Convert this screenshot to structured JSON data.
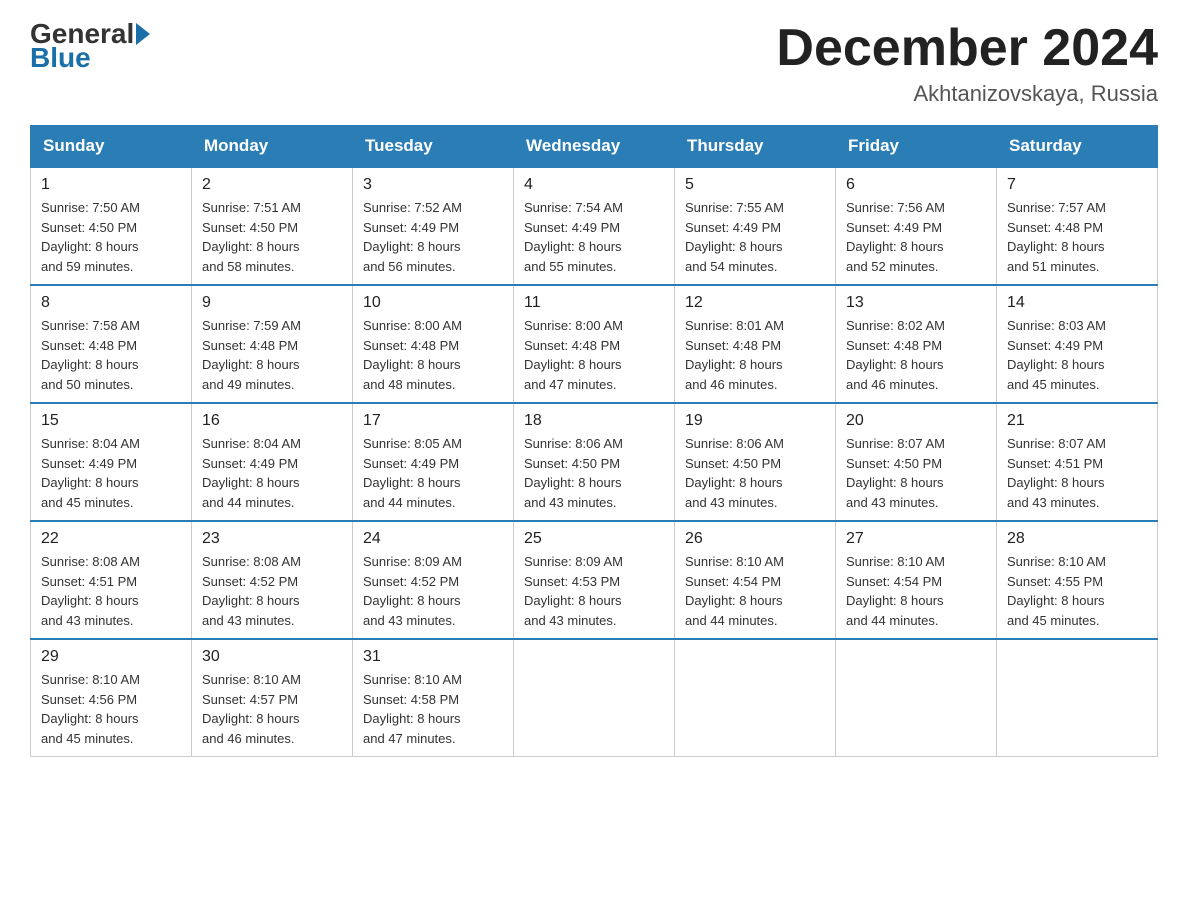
{
  "logo": {
    "general": "General",
    "blue": "Blue"
  },
  "header": {
    "month_year": "December 2024",
    "location": "Akhtanizovskaya, Russia"
  },
  "days_of_week": [
    "Sunday",
    "Monday",
    "Tuesday",
    "Wednesday",
    "Thursday",
    "Friday",
    "Saturday"
  ],
  "weeks": [
    [
      {
        "day": "1",
        "sunrise": "7:50 AM",
        "sunset": "4:50 PM",
        "daylight": "8 hours and 59 minutes."
      },
      {
        "day": "2",
        "sunrise": "7:51 AM",
        "sunset": "4:50 PM",
        "daylight": "8 hours and 58 minutes."
      },
      {
        "day": "3",
        "sunrise": "7:52 AM",
        "sunset": "4:49 PM",
        "daylight": "8 hours and 56 minutes."
      },
      {
        "day": "4",
        "sunrise": "7:54 AM",
        "sunset": "4:49 PM",
        "daylight": "8 hours and 55 minutes."
      },
      {
        "day": "5",
        "sunrise": "7:55 AM",
        "sunset": "4:49 PM",
        "daylight": "8 hours and 54 minutes."
      },
      {
        "day": "6",
        "sunrise": "7:56 AM",
        "sunset": "4:49 PM",
        "daylight": "8 hours and 52 minutes."
      },
      {
        "day": "7",
        "sunrise": "7:57 AM",
        "sunset": "4:48 PM",
        "daylight": "8 hours and 51 minutes."
      }
    ],
    [
      {
        "day": "8",
        "sunrise": "7:58 AM",
        "sunset": "4:48 PM",
        "daylight": "8 hours and 50 minutes."
      },
      {
        "day": "9",
        "sunrise": "7:59 AM",
        "sunset": "4:48 PM",
        "daylight": "8 hours and 49 minutes."
      },
      {
        "day": "10",
        "sunrise": "8:00 AM",
        "sunset": "4:48 PM",
        "daylight": "8 hours and 48 minutes."
      },
      {
        "day": "11",
        "sunrise": "8:00 AM",
        "sunset": "4:48 PM",
        "daylight": "8 hours and 47 minutes."
      },
      {
        "day": "12",
        "sunrise": "8:01 AM",
        "sunset": "4:48 PM",
        "daylight": "8 hours and 46 minutes."
      },
      {
        "day": "13",
        "sunrise": "8:02 AM",
        "sunset": "4:48 PM",
        "daylight": "8 hours and 46 minutes."
      },
      {
        "day": "14",
        "sunrise": "8:03 AM",
        "sunset": "4:49 PM",
        "daylight": "8 hours and 45 minutes."
      }
    ],
    [
      {
        "day": "15",
        "sunrise": "8:04 AM",
        "sunset": "4:49 PM",
        "daylight": "8 hours and 45 minutes."
      },
      {
        "day": "16",
        "sunrise": "8:04 AM",
        "sunset": "4:49 PM",
        "daylight": "8 hours and 44 minutes."
      },
      {
        "day": "17",
        "sunrise": "8:05 AM",
        "sunset": "4:49 PM",
        "daylight": "8 hours and 44 minutes."
      },
      {
        "day": "18",
        "sunrise": "8:06 AM",
        "sunset": "4:50 PM",
        "daylight": "8 hours and 43 minutes."
      },
      {
        "day": "19",
        "sunrise": "8:06 AM",
        "sunset": "4:50 PM",
        "daylight": "8 hours and 43 minutes."
      },
      {
        "day": "20",
        "sunrise": "8:07 AM",
        "sunset": "4:50 PM",
        "daylight": "8 hours and 43 minutes."
      },
      {
        "day": "21",
        "sunrise": "8:07 AM",
        "sunset": "4:51 PM",
        "daylight": "8 hours and 43 minutes."
      }
    ],
    [
      {
        "day": "22",
        "sunrise": "8:08 AM",
        "sunset": "4:51 PM",
        "daylight": "8 hours and 43 minutes."
      },
      {
        "day": "23",
        "sunrise": "8:08 AM",
        "sunset": "4:52 PM",
        "daylight": "8 hours and 43 minutes."
      },
      {
        "day": "24",
        "sunrise": "8:09 AM",
        "sunset": "4:52 PM",
        "daylight": "8 hours and 43 minutes."
      },
      {
        "day": "25",
        "sunrise": "8:09 AM",
        "sunset": "4:53 PM",
        "daylight": "8 hours and 43 minutes."
      },
      {
        "day": "26",
        "sunrise": "8:10 AM",
        "sunset": "4:54 PM",
        "daylight": "8 hours and 44 minutes."
      },
      {
        "day": "27",
        "sunrise": "8:10 AM",
        "sunset": "4:54 PM",
        "daylight": "8 hours and 44 minutes."
      },
      {
        "day": "28",
        "sunrise": "8:10 AM",
        "sunset": "4:55 PM",
        "daylight": "8 hours and 45 minutes."
      }
    ],
    [
      {
        "day": "29",
        "sunrise": "8:10 AM",
        "sunset": "4:56 PM",
        "daylight": "8 hours and 45 minutes."
      },
      {
        "day": "30",
        "sunrise": "8:10 AM",
        "sunset": "4:57 PM",
        "daylight": "8 hours and 46 minutes."
      },
      {
        "day": "31",
        "sunrise": "8:10 AM",
        "sunset": "4:58 PM",
        "daylight": "8 hours and 47 minutes."
      },
      null,
      null,
      null,
      null
    ]
  ]
}
